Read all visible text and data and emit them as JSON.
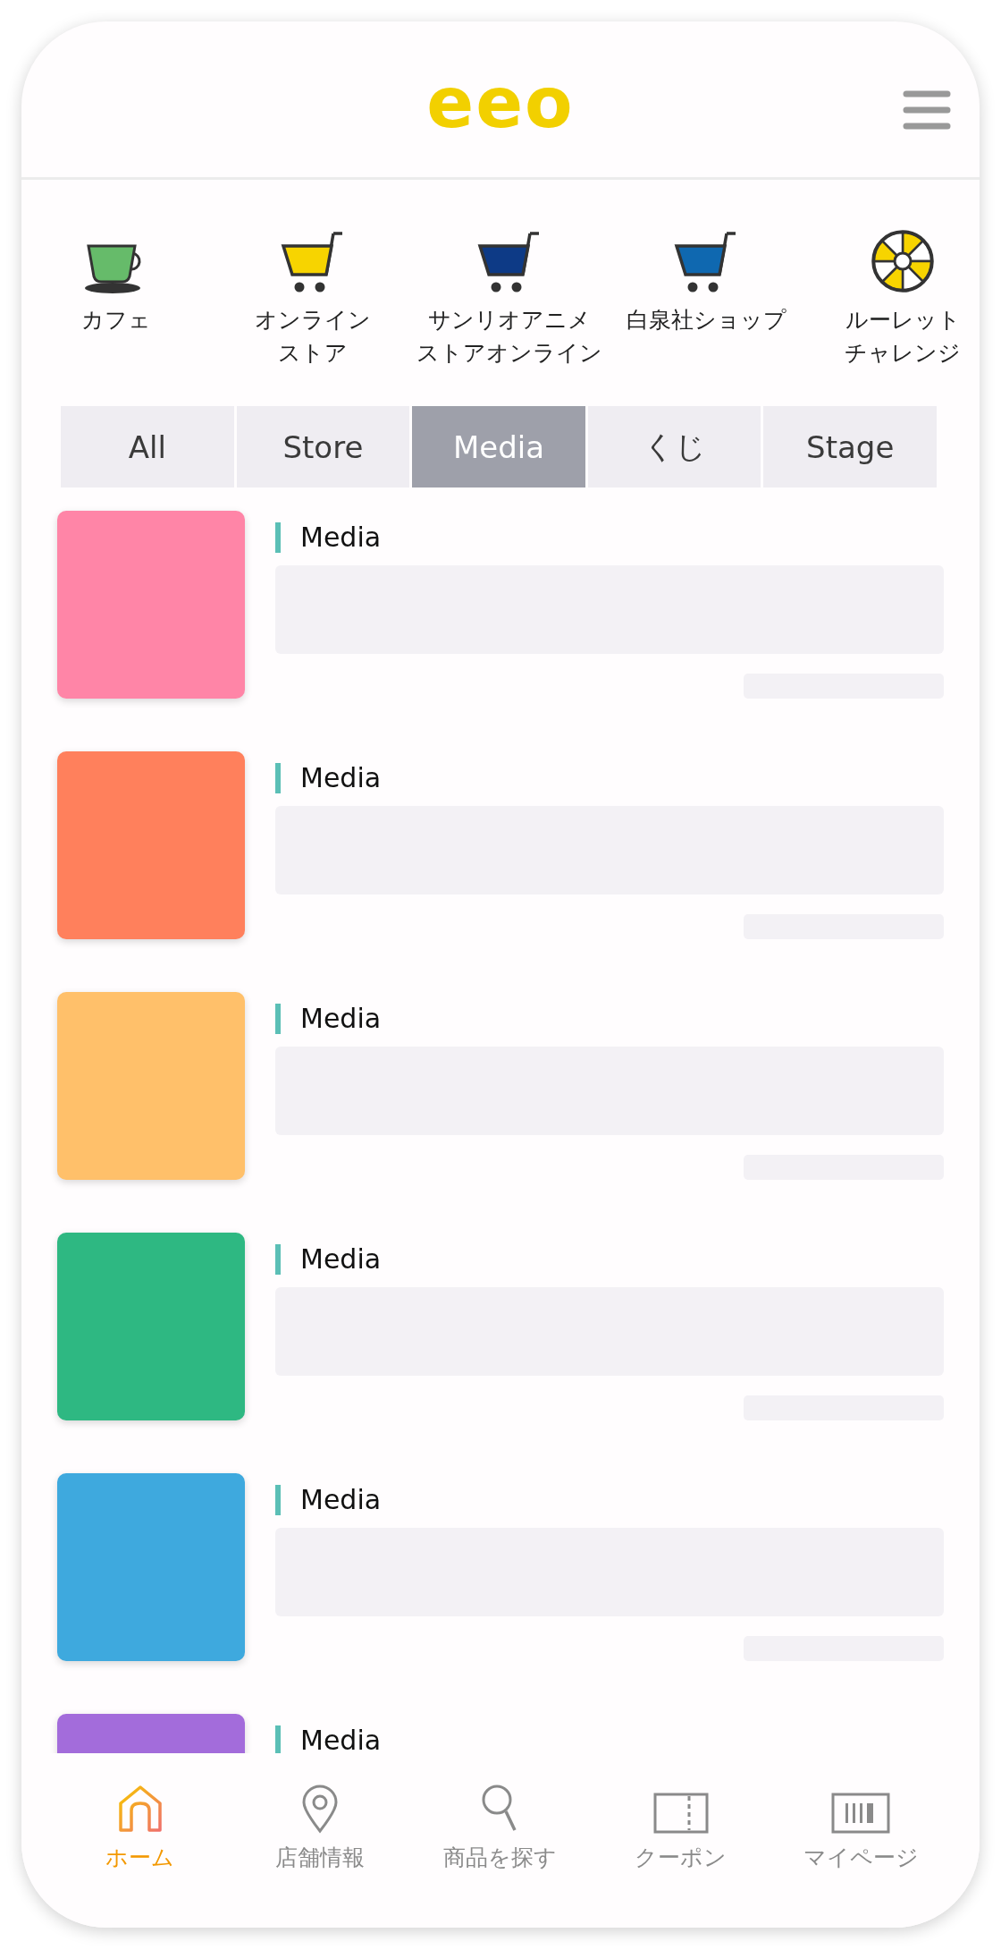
{
  "header": {
    "logo": "eeo"
  },
  "shortcuts": [
    {
      "kind": "cafe",
      "color": "#66bb6a",
      "lines": [
        "カフェ"
      ]
    },
    {
      "kind": "cart",
      "color": "#f7d400",
      "lines": [
        "オンライン",
        "ストア"
      ]
    },
    {
      "kind": "cart",
      "color": "#0d3a86",
      "lines": [
        "サンリオアニメ",
        "ストアオンライン"
      ]
    },
    {
      "kind": "cart",
      "color": "#0f68b0",
      "lines": [
        "白泉社ショップ"
      ]
    },
    {
      "kind": "roulette",
      "color": "#f7d400",
      "lines": [
        "ルーレット",
        "チャレンジ"
      ]
    }
  ],
  "tabs": [
    {
      "label": "All",
      "selected": false
    },
    {
      "label": "Store",
      "selected": false
    },
    {
      "label": "Media",
      "selected": true
    },
    {
      "label": "くじ",
      "selected": false
    },
    {
      "label": "Stage",
      "selected": false
    }
  ],
  "items": [
    {
      "tag": "Media",
      "color": "#ff85a7"
    },
    {
      "tag": "Media",
      "color": "#ff805c"
    },
    {
      "tag": "Media",
      "color": "#ffc06a"
    },
    {
      "tag": "Media",
      "color": "#2eb882"
    },
    {
      "tag": "Media",
      "color": "#3ea9de"
    },
    {
      "tag": "Media",
      "color": "#a36cdb"
    }
  ],
  "nav": [
    {
      "kind": "home",
      "label": "ホーム",
      "selected": true
    },
    {
      "kind": "pin",
      "label": "店舗情報",
      "selected": false
    },
    {
      "kind": "search",
      "label": "商品を探す",
      "selected": false
    },
    {
      "kind": "coupon",
      "label": "クーポン",
      "selected": false
    },
    {
      "kind": "barcode",
      "label": "マイページ",
      "selected": false
    }
  ]
}
